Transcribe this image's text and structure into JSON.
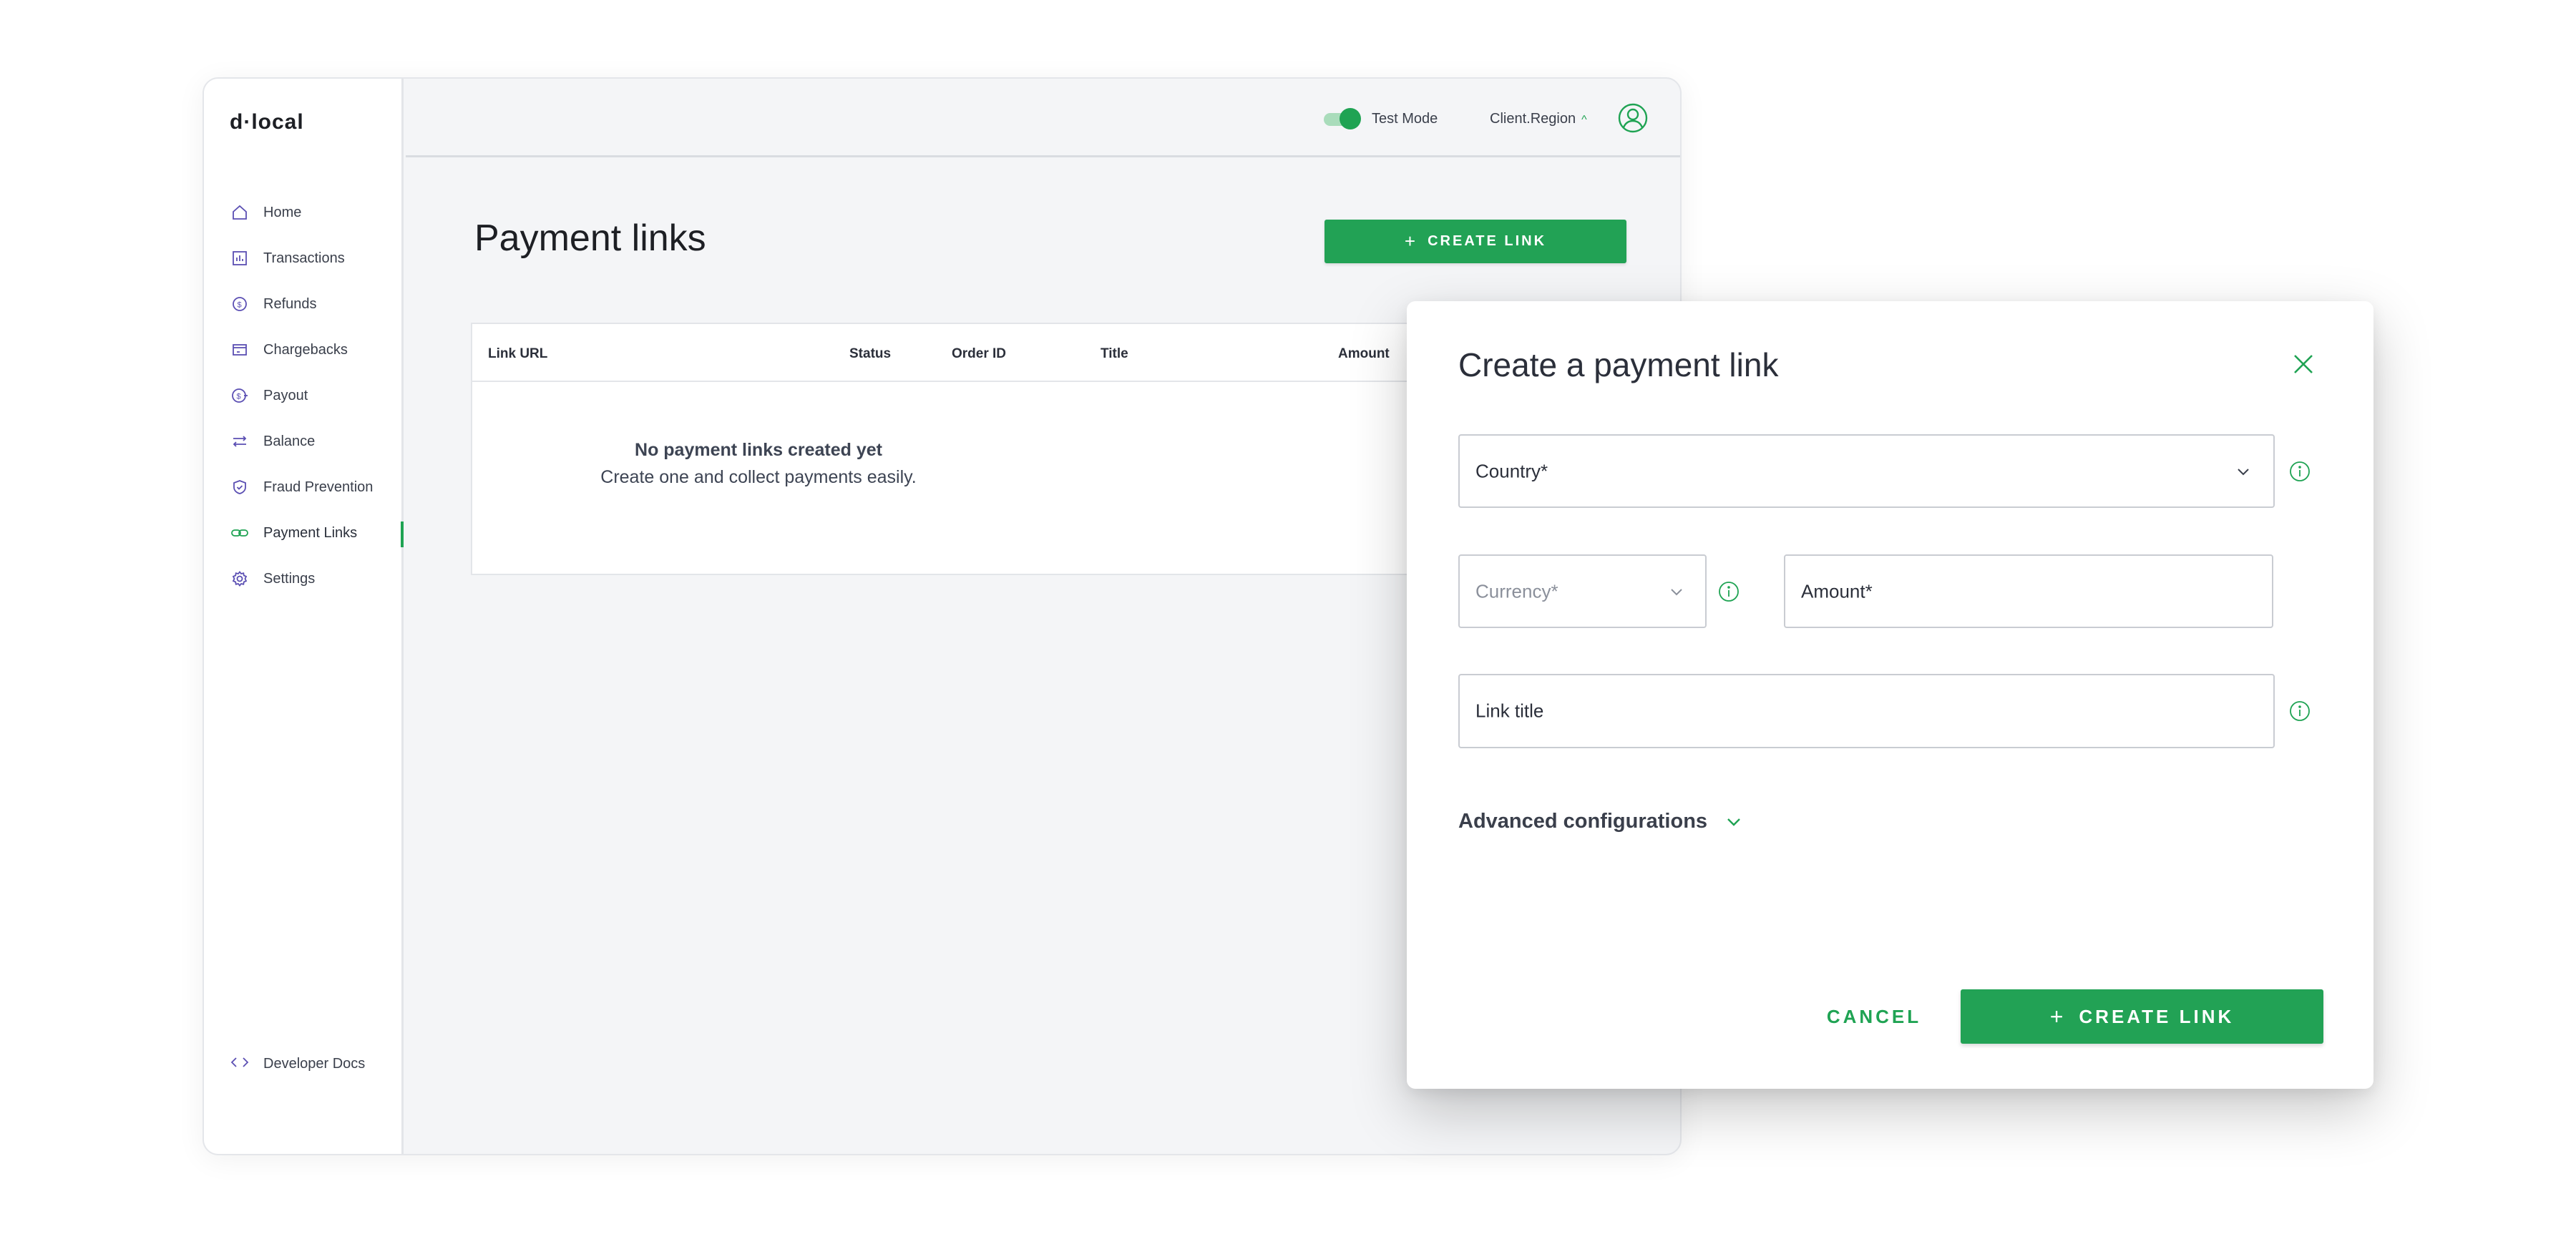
{
  "brand": {
    "logo_left": "d",
    "logo_dot": "·",
    "logo_right": "local",
    "accent": "#22a255",
    "icon_color": "#5b4fb3"
  },
  "topbar": {
    "test_mode_label": "Test Mode",
    "test_mode_on": true,
    "region_label": "Client.Region",
    "region_chevron": "^"
  },
  "sidebar": {
    "items": [
      {
        "label": "Home",
        "icon": "home-icon"
      },
      {
        "label": "Transactions",
        "icon": "transactions-icon"
      },
      {
        "label": "Refunds",
        "icon": "refunds-icon"
      },
      {
        "label": "Chargebacks",
        "icon": "chargebacks-icon"
      },
      {
        "label": "Payout",
        "icon": "payout-icon"
      },
      {
        "label": "Balance",
        "icon": "balance-icon"
      },
      {
        "label": "Fraud Prevention",
        "icon": "shield-icon"
      },
      {
        "label": "Payment Links",
        "icon": "link-icon",
        "active": true
      },
      {
        "label": "Settings",
        "icon": "gear-icon"
      }
    ],
    "developer_docs": "Developer Docs"
  },
  "main": {
    "title": "Payment links",
    "create_button": "CREATE LINK",
    "table": {
      "columns": [
        "Link URL",
        "Status",
        "Order ID",
        "Title",
        "Amount"
      ],
      "empty_title": "No payment links created yet",
      "empty_subtitle": "Create one and collect payments easily."
    }
  },
  "modal": {
    "title": "Create a payment link",
    "country_placeholder": "Country*",
    "currency_placeholder": "Currency*",
    "amount_placeholder": "Amount*",
    "link_title_placeholder": "Link title",
    "advanced_label": "Advanced configurations",
    "cancel_label": "CANCEL",
    "create_label": "CREATE LINK"
  }
}
